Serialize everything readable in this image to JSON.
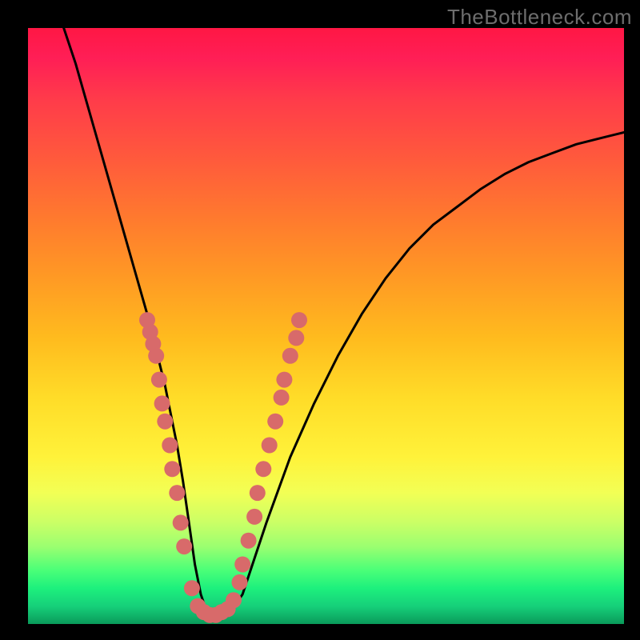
{
  "watermark": "TheBottleneck.com",
  "chart_data": {
    "type": "line",
    "title": "",
    "xlabel": "",
    "ylabel": "",
    "xlim": [
      0,
      100
    ],
    "ylim": [
      0,
      100
    ],
    "curve": {
      "name": "bottleneck-curve",
      "x": [
        6,
        8,
        10,
        12,
        14,
        16,
        18,
        20,
        22,
        23,
        24,
        25,
        26,
        27,
        28,
        29,
        30,
        31,
        32,
        33,
        34,
        36,
        38,
        40,
        44,
        48,
        52,
        56,
        60,
        64,
        68,
        72,
        76,
        80,
        84,
        88,
        92,
        96,
        100
      ],
      "y": [
        100,
        94,
        87,
        80,
        73,
        66,
        59,
        52,
        44,
        40,
        35,
        30,
        24,
        17,
        10,
        5,
        2,
        1,
        1,
        1,
        2,
        5,
        11,
        17,
        28,
        37,
        45,
        52,
        58,
        63,
        67,
        70,
        73,
        75.5,
        77.5,
        79,
        80.5,
        81.5,
        82.5
      ]
    },
    "markers": {
      "name": "sample-points",
      "color": "#d86a6a",
      "radius_px": 10,
      "points": [
        {
          "x": 20.0,
          "y": 51
        },
        {
          "x": 20.5,
          "y": 49
        },
        {
          "x": 21.0,
          "y": 47
        },
        {
          "x": 21.5,
          "y": 45
        },
        {
          "x": 22.0,
          "y": 41
        },
        {
          "x": 22.5,
          "y": 37
        },
        {
          "x": 23.0,
          "y": 34
        },
        {
          "x": 23.8,
          "y": 30
        },
        {
          "x": 24.2,
          "y": 26
        },
        {
          "x": 25.0,
          "y": 22
        },
        {
          "x": 25.6,
          "y": 17
        },
        {
          "x": 26.2,
          "y": 13
        },
        {
          "x": 27.5,
          "y": 6
        },
        {
          "x": 28.5,
          "y": 3
        },
        {
          "x": 29.5,
          "y": 2
        },
        {
          "x": 30.5,
          "y": 1.5
        },
        {
          "x": 31.5,
          "y": 1.5
        },
        {
          "x": 32.5,
          "y": 2
        },
        {
          "x": 33.5,
          "y": 2.5
        },
        {
          "x": 34.5,
          "y": 4
        },
        {
          "x": 35.5,
          "y": 7
        },
        {
          "x": 36.0,
          "y": 10
        },
        {
          "x": 37.0,
          "y": 14
        },
        {
          "x": 38.0,
          "y": 18
        },
        {
          "x": 38.5,
          "y": 22
        },
        {
          "x": 39.5,
          "y": 26
        },
        {
          "x": 40.5,
          "y": 30
        },
        {
          "x": 41.5,
          "y": 34
        },
        {
          "x": 42.5,
          "y": 38
        },
        {
          "x": 43.0,
          "y": 41
        },
        {
          "x": 44.0,
          "y": 45
        },
        {
          "x": 45.0,
          "y": 48
        },
        {
          "x": 45.5,
          "y": 51
        }
      ]
    }
  }
}
